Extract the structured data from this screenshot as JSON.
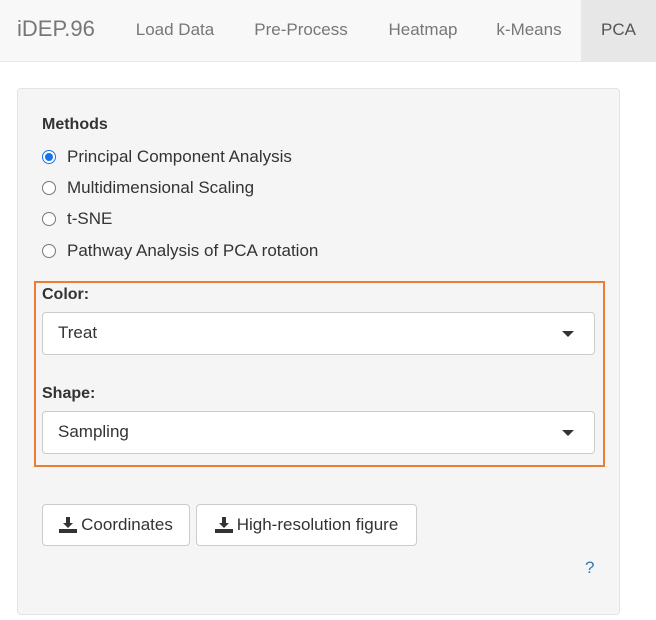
{
  "navbar": {
    "brand": "iDEP.96",
    "tabs": [
      "Load Data",
      "Pre-Process",
      "Heatmap",
      "k-Means",
      "PCA"
    ],
    "active_tab": "PCA"
  },
  "methods": {
    "label": "Methods",
    "options": [
      "Principal Component Analysis",
      "Multidimensional Scaling",
      "t-SNE",
      "Pathway Analysis of PCA rotation"
    ],
    "selected": "Principal Component Analysis"
  },
  "color": {
    "label": "Color:",
    "value": "Treat"
  },
  "shape": {
    "label": "Shape:",
    "value": "Sampling"
  },
  "buttons": {
    "coordinates": "Coordinates",
    "high_res": "High-resolution figure"
  },
  "help": "?",
  "colors": {
    "highlight": "#ed7d31",
    "accent": "#1a73e8"
  }
}
